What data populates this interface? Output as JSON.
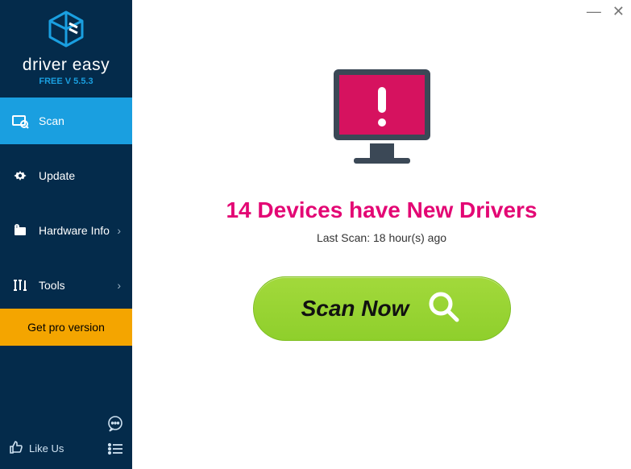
{
  "app": {
    "title": "driver easy",
    "version_label": "FREE V 5.5.3"
  },
  "sidebar": {
    "items": [
      {
        "label": "Scan",
        "has_chevron": false
      },
      {
        "label": "Update",
        "has_chevron": false
      },
      {
        "label": "Hardware Info",
        "has_chevron": true
      },
      {
        "label": "Tools",
        "has_chevron": true
      }
    ],
    "pro_label": "Get pro version",
    "like_label": "Like Us"
  },
  "main": {
    "headline": "14 Devices have New Drivers",
    "last_scan": "Last Scan: 18 hour(s) ago",
    "scan_button_label": "Scan Now"
  },
  "colors": {
    "accent_pink": "#e30774",
    "sidebar_bg": "#042b4b",
    "active_bg": "#1a9fe0",
    "pro_bg": "#f4a500",
    "scan_green": "#8fcf2c"
  }
}
